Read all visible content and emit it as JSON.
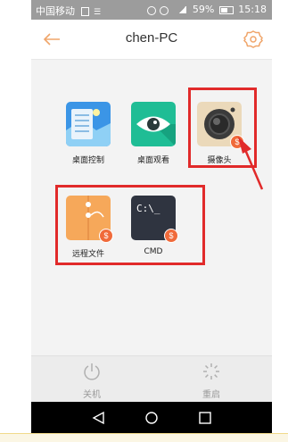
{
  "status_bar": {
    "carrier": "中国移动",
    "battery": "59%",
    "time": "15:18"
  },
  "header": {
    "title": "chen-PC",
    "back_icon": "arrow-left-icon",
    "settings_icon": "gear-icon"
  },
  "tiles": [
    {
      "label": "桌面控制",
      "icon": "desktop-control-icon"
    },
    {
      "label": "桌面观看",
      "icon": "eye-icon"
    },
    {
      "label": "摄像头",
      "icon": "camera-icon",
      "badge": "$"
    },
    {
      "label": "远程文件",
      "icon": "folder-icon",
      "badge": "$"
    },
    {
      "label": "CMD",
      "icon": "terminal-icon",
      "badge": "$",
      "screen_text": "C:\\_"
    }
  ],
  "bottom_bar": {
    "shutdown_label": "关机",
    "restart_label": "重启"
  },
  "colors": {
    "accent": "#f0a56a",
    "highlight": "#e12a2a",
    "badge": "#f06a3a"
  }
}
